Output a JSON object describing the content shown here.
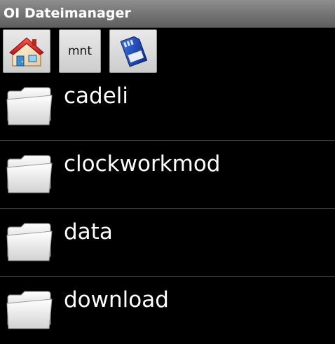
{
  "app": {
    "title": "OI Dateimanager"
  },
  "toolbar": {
    "home_icon": "home-icon",
    "path_button_label": "mnt",
    "sdcard_icon": "sdcard-icon"
  },
  "files": [
    {
      "name": "cadeli",
      "icon": "folder-icon"
    },
    {
      "name": "clockworkmod",
      "icon": "folder-icon"
    },
    {
      "name": "data",
      "icon": "folder-icon"
    },
    {
      "name": "download",
      "icon": "folder-icon"
    }
  ],
  "colors": {
    "background": "#000000",
    "titlebar": "#777777",
    "text": "#ffffff"
  }
}
